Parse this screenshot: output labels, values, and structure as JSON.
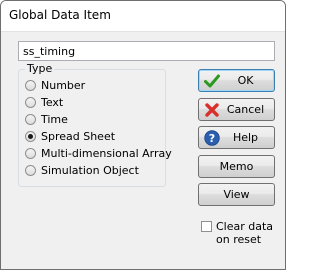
{
  "window": {
    "title": "Global Data Item"
  },
  "name_field": {
    "value": "ss_timing"
  },
  "type_group": {
    "legend": "Type",
    "options": [
      {
        "label": "Number",
        "selected": false
      },
      {
        "label": "Text",
        "selected": false
      },
      {
        "label": "Time",
        "selected": false
      },
      {
        "label": "Spread Sheet",
        "selected": true
      },
      {
        "label": "Multi-dimensional Array",
        "selected": false
      },
      {
        "label": "Simulation Object",
        "selected": false
      }
    ]
  },
  "buttons": {
    "ok": {
      "label": "OK",
      "icon": "check-icon"
    },
    "cancel": {
      "label": "Cancel",
      "icon": "cross-icon"
    },
    "help": {
      "label": "Help",
      "icon": "help-icon"
    },
    "memo": {
      "label": "Memo"
    },
    "view": {
      "label": "View"
    }
  },
  "clear_on_reset": {
    "label": "Clear data on reset",
    "checked": false
  },
  "colors": {
    "check": "#2a9a1e",
    "cross": "#d8302a",
    "help": "#2a5fb0"
  }
}
